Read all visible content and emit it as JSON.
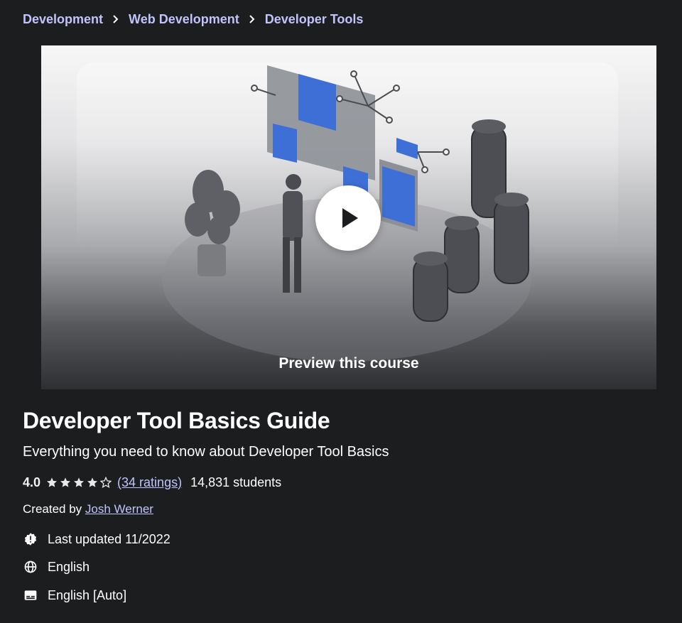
{
  "breadcrumb": {
    "items": [
      "Development",
      "Web Development",
      "Developer Tools"
    ]
  },
  "preview": {
    "label": "Preview this course",
    "play_icon": "play-icon"
  },
  "course": {
    "title": "Developer Tool Basics Guide",
    "subtitle": "Everything you need to know about Developer Tool Basics",
    "rating": "4.0",
    "rating_stars": 4,
    "ratings_count": "(34 ratings)",
    "students": "14,831 students",
    "created_by_label": "Created by",
    "author": "Josh Werner",
    "last_updated": "Last updated 11/2022",
    "language": "English",
    "captions": "English [Auto]"
  },
  "icons": {
    "last_updated": "alert-badge-icon",
    "language": "globe-icon",
    "captions": "closed-captions-icon"
  },
  "colors": {
    "background": "#1c1d1f",
    "link": "#c0c4fc",
    "text": "#ffffff"
  }
}
